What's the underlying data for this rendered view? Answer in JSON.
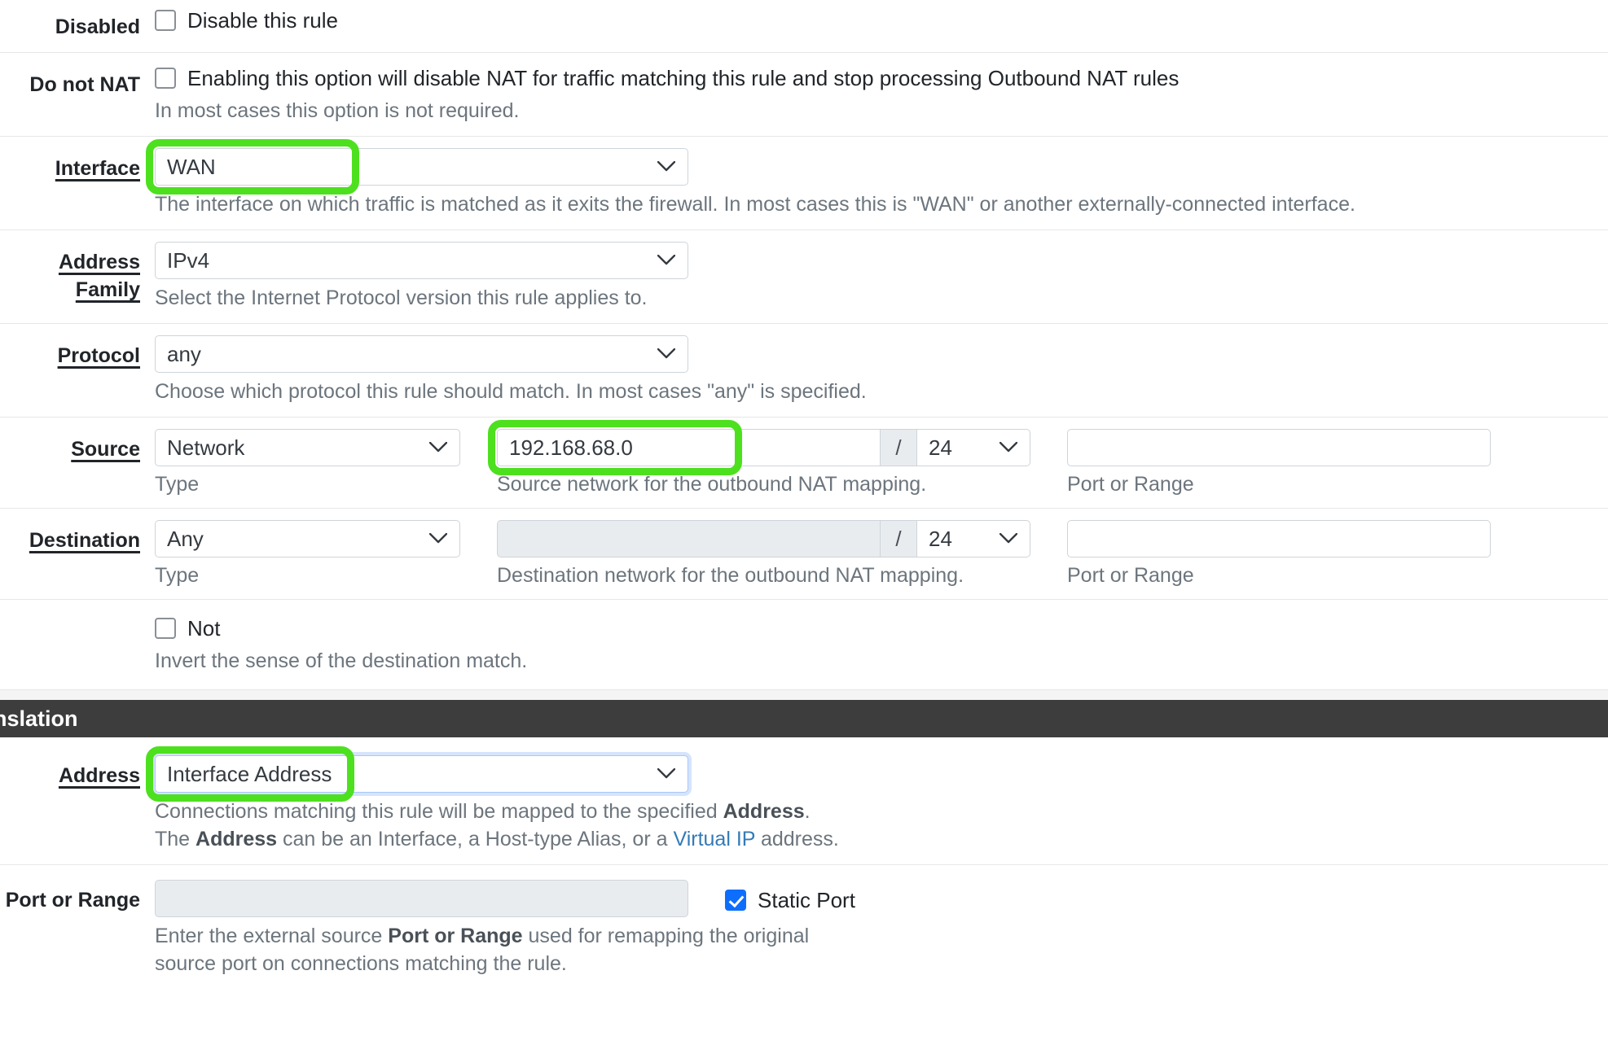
{
  "annotation": {
    "color": "#4de01e"
  },
  "form": {
    "rows": {
      "disabled": {
        "label": "Disabled",
        "checkbox_label": "Disable this rule",
        "checked": false
      },
      "donotnat": {
        "label": "Do not NAT",
        "checkbox_label": "Enabling this option will disable NAT for traffic matching this rule and stop processing Outbound NAT rules",
        "checked": false,
        "help": "In most cases this option is not required."
      },
      "interface": {
        "label": "Interface",
        "value": "WAN",
        "help": "The interface on which traffic is matched as it exits the firewall. In most cases this is \"WAN\" or another externally-connected interface."
      },
      "address_family": {
        "label": "Address Family",
        "value": "IPv4",
        "help": "Select the Internet Protocol version this rule applies to."
      },
      "protocol": {
        "label": "Protocol",
        "value": "any",
        "help": "Choose which protocol this rule should match. In most cases \"any\" is specified."
      },
      "source": {
        "label": "Source",
        "type_value": "Network",
        "type_caption": "Type",
        "network_value": "192.168.68.0",
        "network_caption": "Source network for the outbound NAT mapping.",
        "slash": "/",
        "cidr_value": "24",
        "port_value": "",
        "port_caption": "Port or Range"
      },
      "destination": {
        "label": "Destination",
        "type_value": "Any",
        "type_caption": "Type",
        "network_value": "",
        "network_caption": "Destination network for the outbound NAT mapping.",
        "slash": "/",
        "cidr_value": "24",
        "port_value": "",
        "port_caption": "Port or Range"
      },
      "not": {
        "checkbox_label": "Not",
        "checked": false,
        "help": "Invert the sense of the destination match."
      }
    },
    "translation_section": {
      "title": "nslation",
      "address": {
        "label": "Address",
        "value": "Interface Address",
        "help_line1_a": "Connections matching this rule will be mapped to the specified ",
        "help_line1_b": "Address",
        "help_line1_c": ".",
        "help_line2_a": "The ",
        "help_line2_b": "Address",
        "help_line2_c": " can be an Interface, a Host-type Alias, or a ",
        "help_line2_link": "Virtual IP",
        "help_line2_d": " address."
      },
      "port_or_range": {
        "label": "Port or Range",
        "value": "",
        "static_port_label": "Static Port",
        "static_port_checked": true,
        "help_line1_a": "Enter the external source ",
        "help_line1_b": "Port or Range",
        "help_line1_c": " used for remapping the original",
        "help_line2": "source port on connections matching the rule."
      }
    }
  }
}
